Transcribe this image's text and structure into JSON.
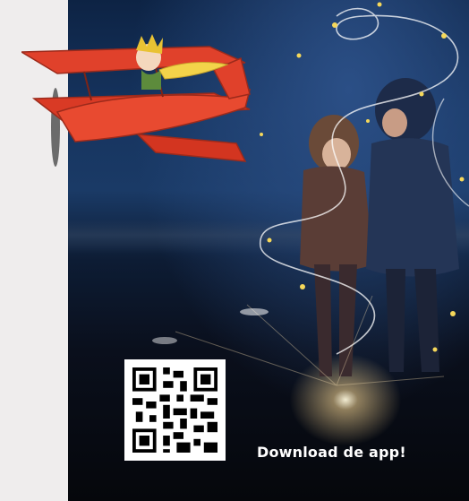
{
  "ad": {
    "cta_text": "Download de app!",
    "qr_icon": "qr-code-icon",
    "illustration": "red-airplane-with-little-prince",
    "colors": {
      "plane": "#e0412b",
      "scarf": "#f3d34a",
      "sky_top": "#0d2344",
      "cta": "#ffffff"
    }
  }
}
